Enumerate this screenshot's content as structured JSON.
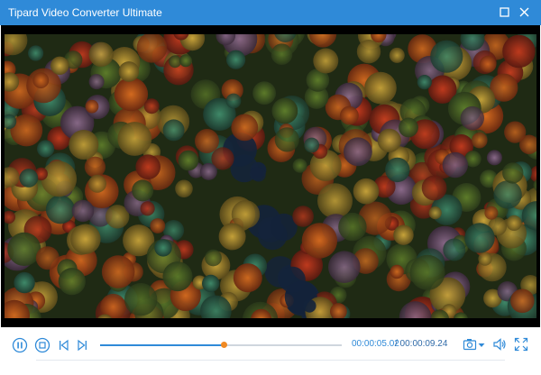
{
  "window": {
    "title": "Tipard Video Converter Ultimate"
  },
  "titlebar_controls": [
    {
      "name": "maximize-icon"
    },
    {
      "name": "close-icon"
    }
  ],
  "video": {
    "content": "aerial-autumn-forest"
  },
  "player": {
    "progress_fraction": 0.51,
    "current_time": "00:00:05.02",
    "total_time": "/ 00:00:09.24",
    "icons": [
      "pause-icon",
      "stop-icon",
      "previous-icon",
      "next-icon",
      "snapshot-icon",
      "chevron-down-icon",
      "volume-icon",
      "fullscreen-icon"
    ]
  },
  "colors": {
    "accent": "#2f8ad8",
    "progress_thumb": "#f08a24",
    "video_background": "#000000"
  }
}
